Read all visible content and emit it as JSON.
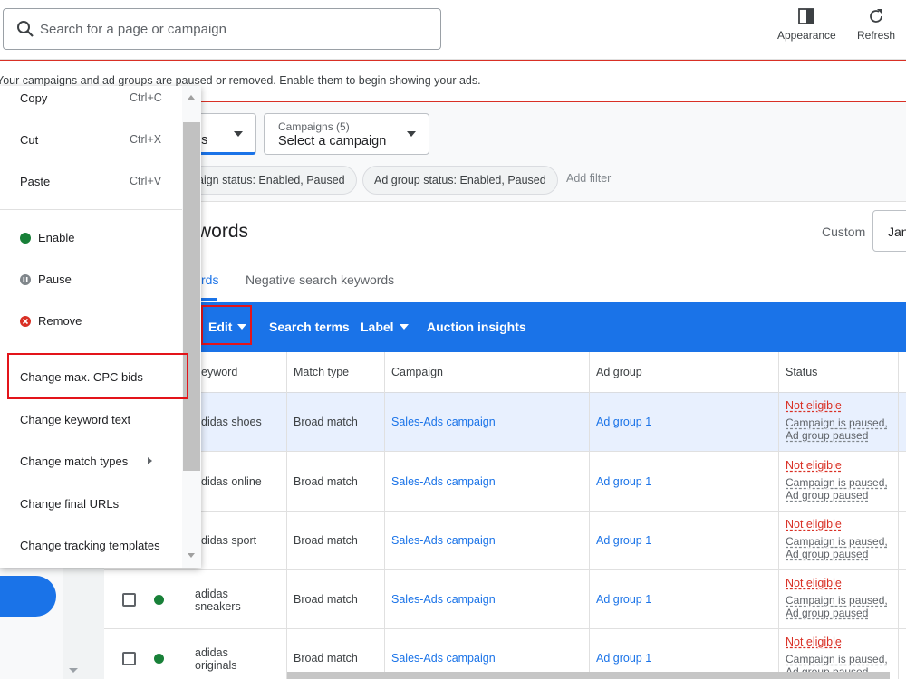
{
  "search": {
    "placeholder": "Search for a page or campaign"
  },
  "toolbar": {
    "appearance_label": "Appearance",
    "refresh_label": "Refresh"
  },
  "notice": {
    "text": "Your campaigns and ad groups are paused or removed. Enable them to begin showing your ads."
  },
  "pickers": {
    "left_value": "gns",
    "campaigns_label": "Campaigns (5)",
    "campaigns_value": "Select a campaign"
  },
  "filters": {
    "campaign_status": "aign status: Enabled, Paused",
    "adgroup_status": "Ad group status: Enabled, Paused",
    "add_filter": "Add filter"
  },
  "page": {
    "title": "words",
    "custom_label": "Custom",
    "date_value": "Jan"
  },
  "tabs": {
    "active": "rds",
    "negative": "Negative search keywords"
  },
  "actions": {
    "edit": "Edit",
    "search_terms": "Search terms",
    "label": "Label",
    "auction_insights": "Auction insights"
  },
  "table": {
    "headers": {
      "keyword": "eyword",
      "match_type": "Match type",
      "campaign": "Campaign",
      "ad_group": "Ad group",
      "status": "Status"
    },
    "rows": [
      {
        "keyword": "didas shoes",
        "keyword2": "",
        "match": "Broad match",
        "campaign": "Sales-Ads campaign",
        "adgroup": "Ad group 1",
        "status": "Not eligible",
        "sub1": "Campaign is paused,",
        "sub2": "Ad group paused"
      },
      {
        "keyword": "didas online",
        "keyword2": "",
        "match": "Broad match",
        "campaign": "Sales-Ads campaign",
        "adgroup": "Ad group 1",
        "status": "Not eligible",
        "sub1": "Campaign is paused,",
        "sub2": "Ad group paused"
      },
      {
        "keyword": "didas sport",
        "keyword2": "",
        "match": "Broad match",
        "campaign": "Sales-Ads campaign",
        "adgroup": "Ad group 1",
        "status": "Not eligible",
        "sub1": "Campaign is paused,",
        "sub2": "Ad group paused"
      },
      {
        "keyword": "adidas",
        "keyword2": "sneakers",
        "match": "Broad match",
        "campaign": "Sales-Ads campaign",
        "adgroup": "Ad group 1",
        "status": "Not eligible",
        "sub1": "Campaign is paused,",
        "sub2": "Ad group paused"
      },
      {
        "keyword": "adidas",
        "keyword2": "originals",
        "match": "Broad match",
        "campaign": "Sales-Ads campaign",
        "adgroup": "Ad group 1",
        "status": "Not eligible",
        "sub1": "Campaign is paused,",
        "sub2": "Ad group paused"
      }
    ]
  },
  "menu": {
    "copy": "Copy",
    "copy_sc": "Ctrl+C",
    "cut": "Cut",
    "cut_sc": "Ctrl+X",
    "paste": "Paste",
    "paste_sc": "Ctrl+V",
    "enable": "Enable",
    "pause": "Pause",
    "remove": "Remove",
    "change_cpc": "Change max. CPC bids",
    "change_text": "Change keyword text",
    "change_match": "Change match types",
    "change_urls": "Change final URLs",
    "change_tracking": "Change tracking templates"
  },
  "colors": {
    "accent": "#1a73e8",
    "highlight": "#e3141a",
    "enabled": "#188038",
    "paused": "#80868b",
    "removed": "#d93025"
  }
}
